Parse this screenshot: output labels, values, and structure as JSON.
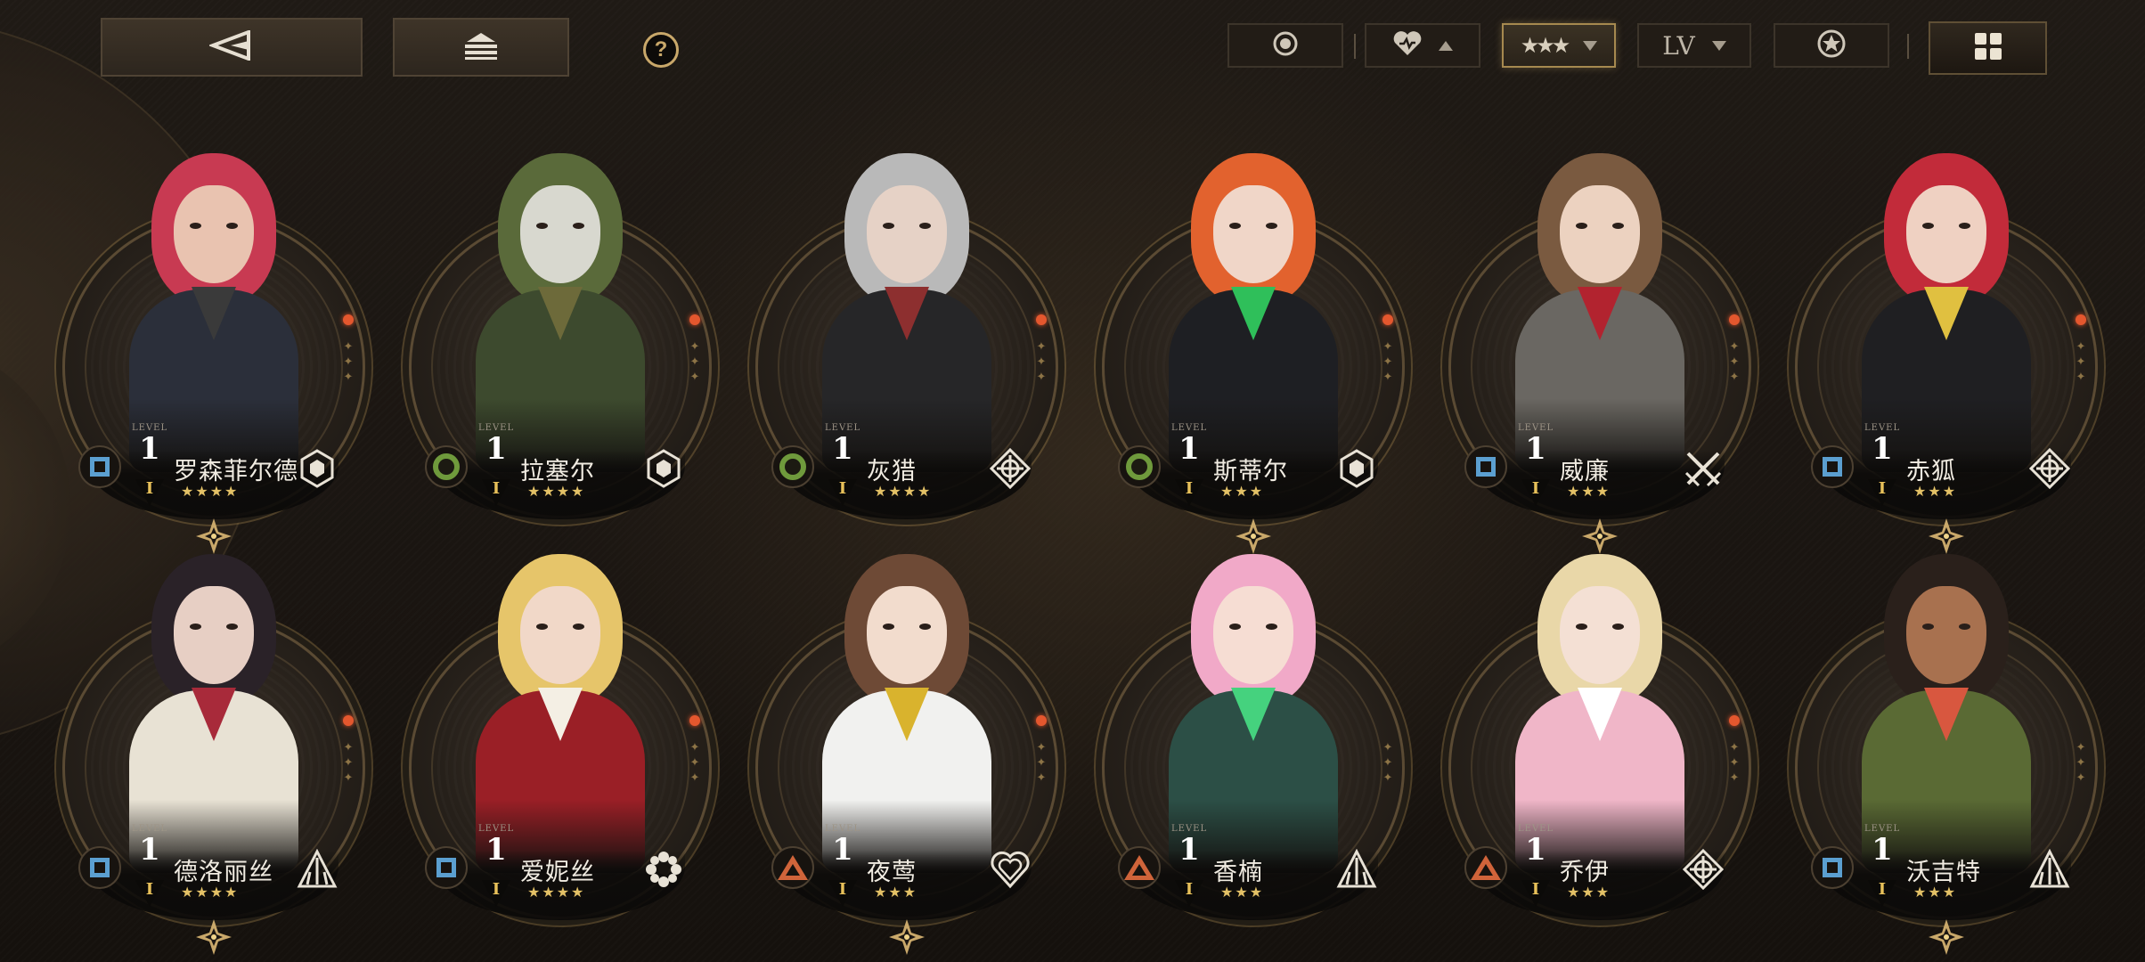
{
  "topbar": {
    "back_icon": "back-triangle-icon",
    "home_icon": "stack-home-icon",
    "help_label": "?",
    "filters": {
      "toggle_icon": "radio-dot-icon",
      "favorite_icon": "heart-icon",
      "favorite_sort_icon": "caret-up-icon",
      "rarity_icon": "three-stars-icon",
      "rarity_sort_icon": "caret-down-icon",
      "level_label": "LV",
      "level_sort_icon": "caret-down-icon",
      "star_icon": "star-badge-icon"
    },
    "view_icon": "grid-view-icon"
  },
  "colors": {
    "accent_gold": "#c9a86a",
    "star_gold": "#e3c166",
    "class_blue": "#5b9fd0",
    "class_green": "#6f9a3c",
    "class_orange": "#d0643a",
    "alert_dot": "#e4572e"
  },
  "characters": [
    {
      "name": "罗森菲尔德",
      "level_label": "LEVEL",
      "level": "1",
      "rank": "I",
      "stars": "★★★★",
      "class_icon": "square",
      "type_icon": "hexagon-cluster-icon",
      "alert": true,
      "diamond": true,
      "palette": {
        "hair": "#c83a52",
        "skin": "#e9c3b0",
        "body": "#2b2f3a",
        "accent": "#3a3a3a"
      }
    },
    {
      "name": "拉塞尔",
      "level_label": "LEVEL",
      "level": "1",
      "rank": "I",
      "stars": "★★★★",
      "class_icon": "circle",
      "type_icon": "hexagon-cluster-icon",
      "alert": true,
      "diamond": false,
      "palette": {
        "hair": "#5a6a3a",
        "skin": "#d8d8cf",
        "body": "#3d4a2e",
        "accent": "#6d6a3a"
      }
    },
    {
      "name": "灰猎",
      "level_label": "LEVEL",
      "level": "1",
      "rank": "I",
      "stars": "★★★★",
      "class_icon": "circle",
      "type_icon": "crosshair-icon",
      "alert": true,
      "diamond": false,
      "palette": {
        "hair": "#b9b9b9",
        "skin": "#e6d2c6",
        "body": "#262628",
        "accent": "#8d2f2f"
      }
    },
    {
      "name": "斯蒂尔",
      "level_label": "LEVEL",
      "level": "1",
      "rank": "I",
      "stars": "★★★",
      "class_icon": "circle",
      "type_icon": "hexagon-cluster-icon",
      "alert": true,
      "diamond": true,
      "palette": {
        "hair": "#e2622e",
        "skin": "#f0d6c8",
        "body": "#1e1f23",
        "accent": "#2fbf5a"
      }
    },
    {
      "name": "威廉",
      "level_label": "LEVEL",
      "level": "1",
      "rank": "I",
      "stars": "★★★",
      "class_icon": "square",
      "type_icon": "crossed-swords-icon",
      "alert": true,
      "diamond": true,
      "palette": {
        "hair": "#7a5a40",
        "skin": "#ecd2c0",
        "body": "#6a6762",
        "accent": "#b2232f"
      }
    },
    {
      "name": "赤狐",
      "level_label": "LEVEL",
      "level": "1",
      "rank": "I",
      "stars": "★★★",
      "class_icon": "square",
      "type_icon": "crosshair-icon",
      "alert": true,
      "diamond": true,
      "palette": {
        "hair": "#c22b3a",
        "skin": "#efd1c2",
        "body": "#1f1f22",
        "accent": "#e0c040"
      }
    },
    {
      "name": "德洛丽丝",
      "level_label": "LEVEL",
      "level": "1",
      "rank": "I",
      "stars": "★★★★",
      "class_icon": "square",
      "type_icon": "spike-triangle-icon",
      "alert": true,
      "diamond": true,
      "palette": {
        "hair": "#2a2228",
        "skin": "#e7cfc4",
        "body": "#e8e2d4",
        "accent": "#a82a3a"
      }
    },
    {
      "name": "爱妮丝",
      "level_label": "LEVEL",
      "level": "1",
      "rank": "I",
      "stars": "★★★★",
      "class_icon": "square",
      "type_icon": "gear-flower-icon",
      "alert": true,
      "diamond": false,
      "palette": {
        "hair": "#e6c56a",
        "skin": "#f1d8c8",
        "body": "#9a1f26",
        "accent": "#f4efe4"
      }
    },
    {
      "name": "夜莺",
      "level_label": "LEVEL",
      "level": "1",
      "rank": "I",
      "stars": "★★★",
      "class_icon": "triangle",
      "type_icon": "heart-outline-icon",
      "alert": true,
      "diamond": true,
      "palette": {
        "hair": "#6e4a36",
        "skin": "#f2dccd",
        "body": "#f1f1ef",
        "accent": "#d9b32d"
      }
    },
    {
      "name": "香楠",
      "level_label": "LEVEL",
      "level": "1",
      "rank": "I",
      "stars": "★★★",
      "class_icon": "triangle",
      "type_icon": "spike-triangle-icon",
      "alert": false,
      "diamond": false,
      "palette": {
        "hair": "#f1a9c8",
        "skin": "#f6ddd3",
        "body": "#2c4f46",
        "accent": "#45d27e"
      }
    },
    {
      "name": "乔伊",
      "level_label": "LEVEL",
      "level": "1",
      "rank": "I",
      "stars": "★★★",
      "class_icon": "triangle",
      "type_icon": "crosshair-icon",
      "alert": true,
      "diamond": false,
      "palette": {
        "hair": "#e9d7a8",
        "skin": "#f4e0d4",
        "body": "#f0b6c8",
        "accent": "#ffffff"
      }
    },
    {
      "name": "沃吉特",
      "level_label": "LEVEL",
      "level": "1",
      "rank": "I",
      "stars": "★★★",
      "class_icon": "square",
      "type_icon": "spike-triangle-icon",
      "alert": false,
      "diamond": true,
      "palette": {
        "hair": "#2a201b",
        "skin": "#a8714f",
        "body": "#5a6a34",
        "accent": "#d8573f"
      }
    }
  ]
}
